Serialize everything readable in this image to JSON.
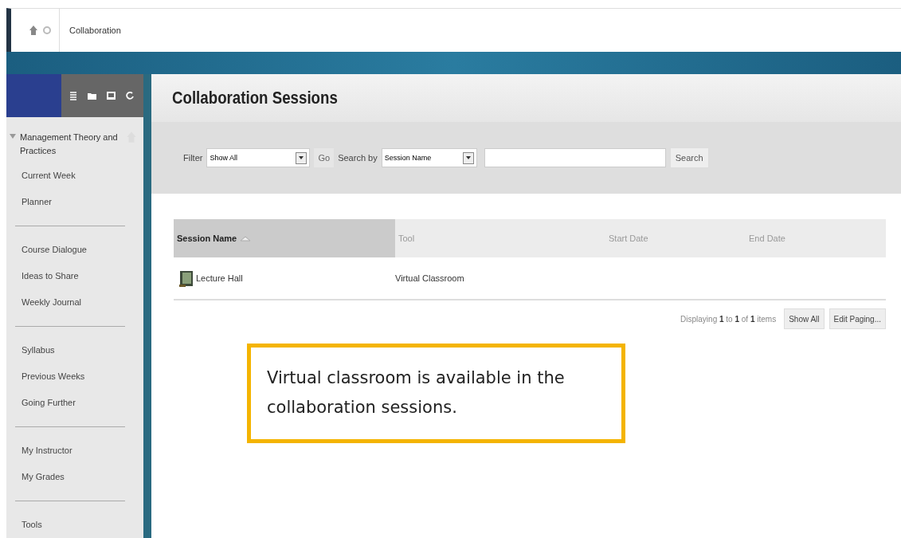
{
  "breadcrumb": {
    "label": "Collaboration"
  },
  "sidebar": {
    "course": {
      "label": "Management Theory and Practices",
      "expanded": true
    },
    "groups": [
      [
        "Current Week",
        "Planner"
      ],
      [
        "Course Dialogue",
        "Ideas to Share",
        "Weekly Journal"
      ],
      [
        "Syllabus",
        "Previous Weeks",
        "Going Further"
      ],
      [
        "My Instructor",
        "My Grades"
      ],
      [
        "Tools"
      ]
    ]
  },
  "page": {
    "title": "Collaboration Sessions"
  },
  "filter": {
    "label": "Filter",
    "value": "Show All",
    "go": "Go",
    "search_label": "Search by",
    "search_value": "Session Name",
    "search_button": "Search"
  },
  "table": {
    "columns": [
      {
        "label": "Session Name",
        "sorted": true
      },
      {
        "label": "Tool",
        "sorted": false
      },
      {
        "label": "Start Date",
        "sorted": false
      },
      {
        "label": "End Date",
        "sorted": false
      }
    ],
    "rows": [
      {
        "name": "Lecture Hall",
        "tool": "Virtual Classroom"
      }
    ]
  },
  "paging": {
    "prefix": "Displaying",
    "from": "1",
    "to_word": "to",
    "to": "1",
    "of_word": "of",
    "total": "1",
    "suffix": "items",
    "buttons": [
      "Show All",
      "Edit Paging..."
    ]
  },
  "callout": {
    "text": "Virtual classroom is available in the collaboration sessions."
  }
}
